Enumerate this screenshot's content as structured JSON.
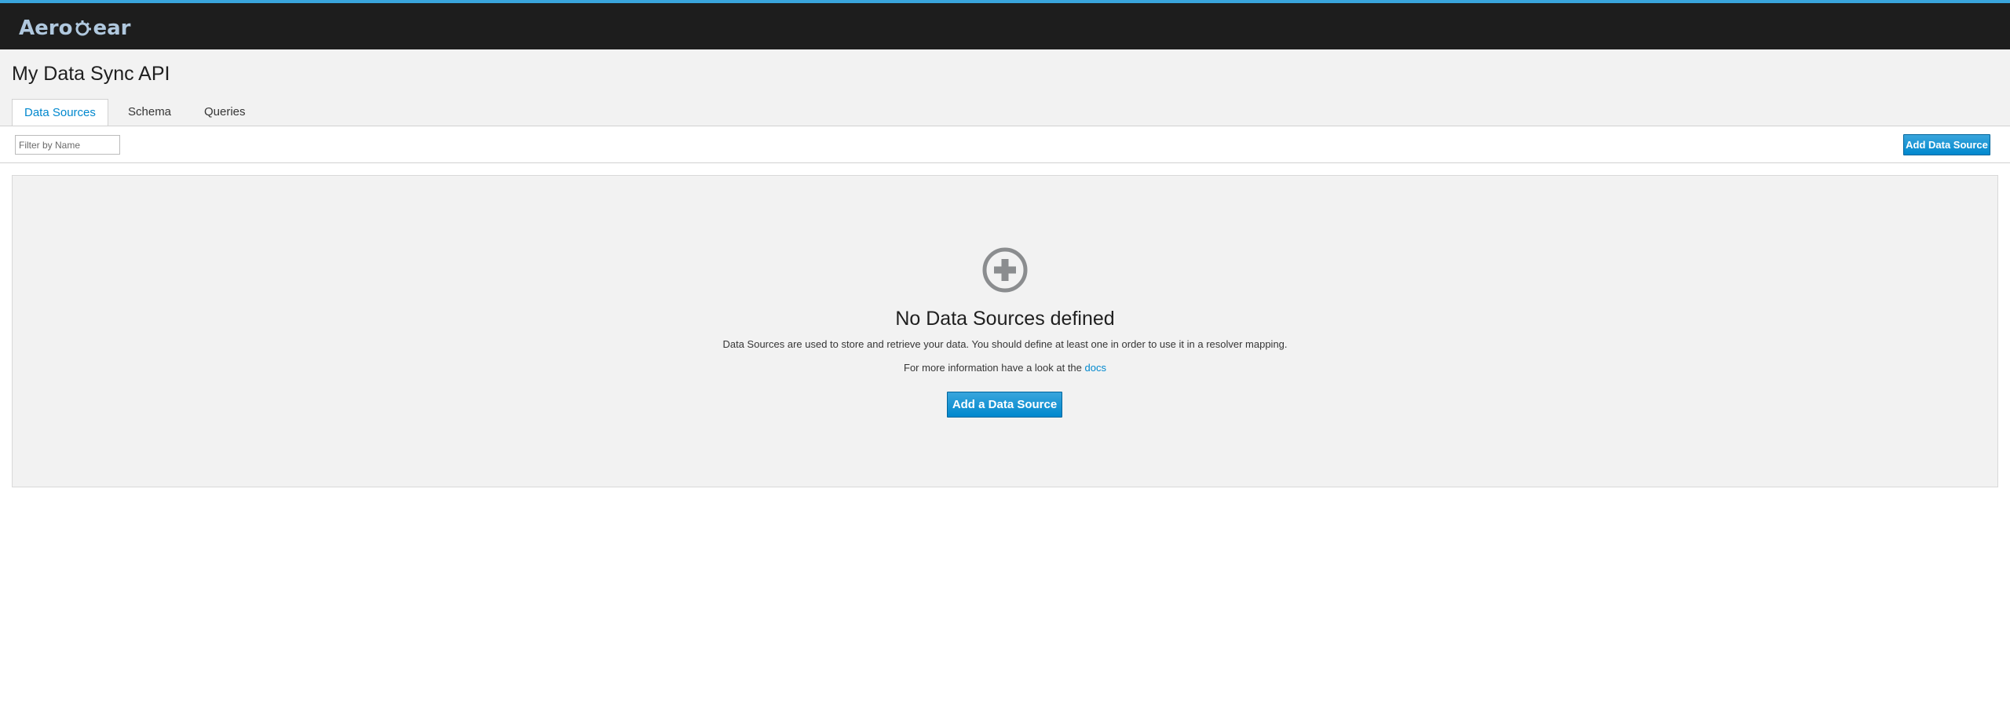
{
  "brand": {
    "logo_text_left": "Aero",
    "logo_text_right": "ear"
  },
  "page": {
    "title": "My Data Sync API"
  },
  "tabs": [
    {
      "label": "Data Sources",
      "active": true
    },
    {
      "label": "Schema",
      "active": false
    },
    {
      "label": "Queries",
      "active": false
    }
  ],
  "toolbar": {
    "filter_placeholder": "Filter by Name",
    "add_button_label": "Add Data Source"
  },
  "empty_state": {
    "icon": "plus-circle-icon",
    "title": "No Data Sources defined",
    "description": "Data Sources are used to store and retrieve your data. You should define at least one in order to use it in a resolver mapping.",
    "more_info_prefix": "For more information have a look at the",
    "docs_link": "docs",
    "action_label": "Add a Data Source"
  },
  "colors": {
    "topbar": "#1d1d1d",
    "accent": "#39a5dc",
    "primary": "#0088ce",
    "panel": "#f2f2f2"
  }
}
